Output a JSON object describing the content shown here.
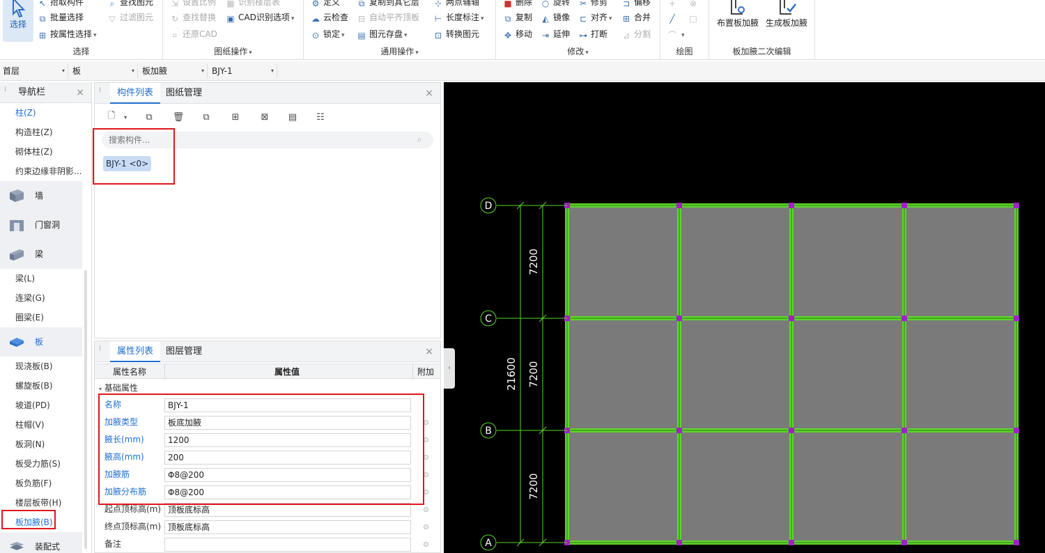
{
  "ribbon": {
    "select_group": {
      "label": "选择",
      "big_label": "选择",
      "items": [
        "拾取构件",
        "批量选择",
        "按属性选择"
      ],
      "items2": [
        "查找图元",
        "过滤图元"
      ]
    },
    "drawing_group": {
      "label": "图纸操作",
      "items": [
        "设置比例",
        "查找替换",
        "还原CAD"
      ],
      "items2": [
        "识别楼层表",
        "CAD识别选项"
      ]
    },
    "common_group": {
      "label": "通用操作",
      "items": [
        "定义",
        "云检查",
        "锁定"
      ],
      "items2": [
        "复制到其它层",
        "自动平齐顶板",
        "图元存盘"
      ],
      "items3": [
        "两点辅轴",
        "长度标注",
        "转换图元"
      ]
    },
    "modify_group": {
      "label": "修改",
      "items": [
        "删除",
        "复制",
        "移动"
      ],
      "items2": [
        "旋转",
        "镜像",
        "延伸"
      ],
      "items3": [
        "修剪",
        "对齐",
        "打断"
      ],
      "items4": [
        "偏移",
        "合并",
        "分割"
      ]
    },
    "draw_group": {
      "label": "绘图"
    },
    "haunch_group": {
      "label": "板加腋二次编辑",
      "btn1": "布置板加腋",
      "btn2": "生成板加腋"
    }
  },
  "selectors": [
    "首层",
    "板",
    "板加腋",
    "BJY-1"
  ],
  "nav": {
    "title": "导航栏",
    "column_items": [
      "柱(Z)",
      "构造柱(Z)",
      "砌体柱(Z)",
      "约束边缘非阴影..."
    ],
    "cat_wall": "墙",
    "cat_opening": "门窗洞",
    "cat_beam": "梁",
    "beam_items": [
      "梁(L)",
      "连梁(G)",
      "圈梁(E)"
    ],
    "cat_slab": "板",
    "slab_items": [
      "现浇板(B)",
      "螺旋板(B)",
      "坡道(PD)",
      "柱帽(V)",
      "板洞(N)",
      "板受力筋(S)",
      "板负筋(F)",
      "楼层板带(H)",
      "板加腋(B)"
    ],
    "cat_prefab": "装配式"
  },
  "comp_panel": {
    "tab1": "构件列表",
    "tab2": "图纸管理",
    "search_placeholder": "搜索构件...",
    "item": "BJY-1 <0>"
  },
  "prop_panel": {
    "tab1": "属性列表",
    "tab2": "图层管理",
    "col_name": "属性名称",
    "col_value": "属性值",
    "col_extra": "附加",
    "section": "基础属性",
    "rows": [
      {
        "name": "名称",
        "value": "BJY-1"
      },
      {
        "name": "加腋类型",
        "value": "板底加腋"
      },
      {
        "name": "腋长(mm)",
        "value": "1200"
      },
      {
        "name": "腋高(mm)",
        "value": "200"
      },
      {
        "name": "加腋筋",
        "value": "Φ8@200"
      },
      {
        "name": "加腋分布筋",
        "value": "Φ8@200"
      },
      {
        "name": "起点顶标高(m)",
        "value": "顶板底标高"
      },
      {
        "name": "终点顶标高(m)",
        "value": "顶板底标高"
      },
      {
        "name": "备注",
        "value": ""
      }
    ]
  },
  "canvas": {
    "axis_labels": [
      "D",
      "C",
      "B",
      "A"
    ],
    "dims": [
      "7200",
      "7200",
      "7200"
    ],
    "total_dim": "21600"
  },
  "colors": {
    "accent": "#1e6fd1",
    "highlight": "#e0161c",
    "beam": "#5dd62c",
    "node": "#a21fc9",
    "slab": "#7a7a7a"
  }
}
